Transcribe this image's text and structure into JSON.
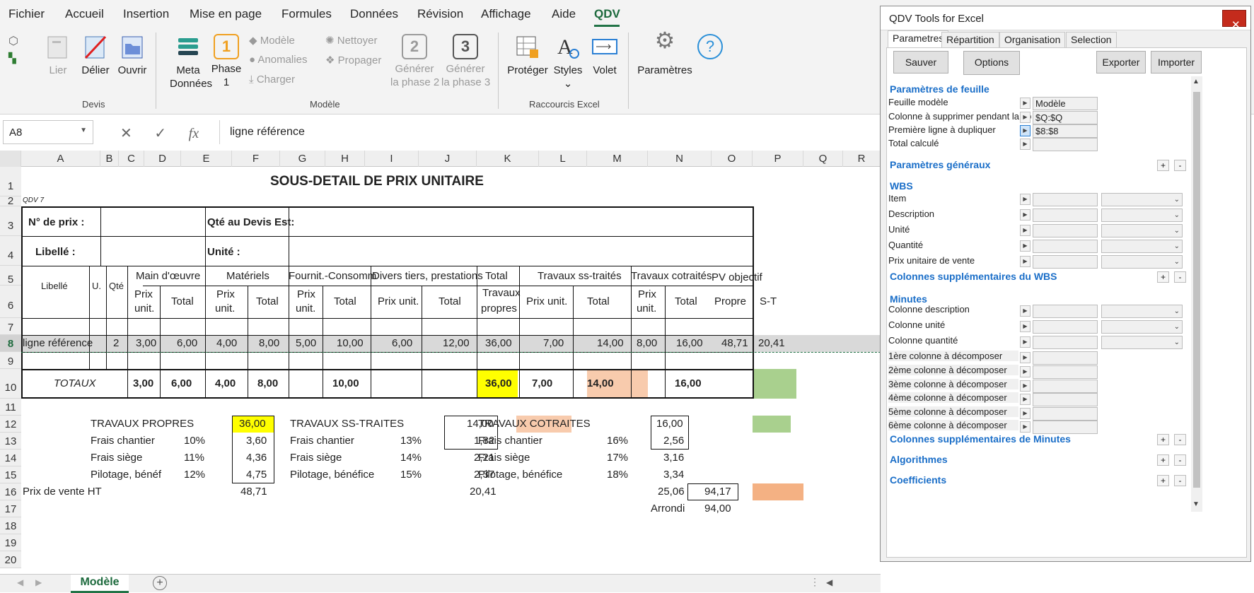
{
  "menu": [
    "Fichier",
    "Accueil",
    "Insertion",
    "Mise en page",
    "Formules",
    "Données",
    "Révision",
    "Affichage",
    "Aide",
    "QDV"
  ],
  "ribbon": {
    "devis": {
      "lier": "Lier",
      "delier": "Délier",
      "ouvrir": "Ouvrir",
      "group": "Devis"
    },
    "modele": {
      "meta1": "Meta",
      "meta2": "Données",
      "phase1a": "Phase",
      "phase1b": "1",
      "phase1_num": "1",
      "modele": "Modèle",
      "anomalies": "Anomalies",
      "charger": "Charger",
      "nettoyer": "Nettoyer",
      "propager": "Propager",
      "gen2a": "Générer",
      "gen2b": "la phase 2",
      "gen2_num": "2",
      "gen3a": "Générer",
      "gen3b": "la phase 3",
      "gen3_num": "3",
      "group": "Modèle"
    },
    "raccourcis": {
      "proteger": "Protéger",
      "styles": "Styles",
      "volet": "Volet",
      "group": "Raccourcis Excel"
    },
    "params": "Paramètres"
  },
  "namebox": "A8",
  "formula": "ligne référence",
  "columns": [
    "A",
    "B",
    "C",
    "D",
    "E",
    "F",
    "G",
    "H",
    "I",
    "J",
    "K",
    "L",
    "M",
    "N",
    "O",
    "P",
    "Q",
    "R"
  ],
  "rows": [
    "1",
    "2",
    "3",
    "4",
    "5",
    "6",
    "7",
    "8",
    "9",
    "10",
    "11",
    "12",
    "13",
    "14",
    "15",
    "16",
    "17",
    "18",
    "19",
    "20"
  ],
  "sheet": {
    "title": "SOUS-DETAIL DE PRIX UNITAIRE",
    "qdv7": "QDV 7",
    "no_prix": "N° de prix :",
    "qte_devis": "Qté au Devis Est:",
    "libelle_h": "Libellé :",
    "unite_h": "Unité :",
    "h_libelle": "Libellé",
    "h_u": "U.",
    "h_qte": "Qté",
    "h_main": "Main d'œuvre",
    "h_mat": "Matériels",
    "h_fourn": "Fournit.-Consomm",
    "h_divers": "Divers tiers, prestations",
    "h_total1": "Total",
    "h_total2": "Travaux",
    "h_total3": "propres",
    "h_sstr": "Travaux ss-traités",
    "h_cotr": "Travaux cotraités",
    "h_pv": "PV objectif",
    "h_prix": "Prix",
    "h_unit": "unit.",
    "h_total": "Total",
    "h_prixunit": "Prix unit.",
    "h_propre": "Propre",
    "h_st": "S-T",
    "row8": {
      "a": "ligne référence",
      "c": "2",
      "d": "3,00",
      "e": "6,00",
      "f": "4,00",
      "g": "8,00",
      "h": "5,00",
      "i": "10,00",
      "j": "6,00",
      "k": "12,00",
      "l": "36,00",
      "m": "7,00",
      "n": "14,00",
      "o": "8,00",
      "p": "16,00",
      "q": "48,71",
      "r": "20,41"
    },
    "totaux": {
      "label": "TOTAUX",
      "d": "3,00",
      "e": "6,00",
      "f": "4,00",
      "g": "8,00",
      "i": "10,00",
      "l": "36,00",
      "m": "7,00",
      "n": "14,00",
      "p": "16,00"
    },
    "summary": {
      "tp": "TRAVAUX PROPRES",
      "tp_v": "36,00",
      "tst": "TRAVAUX SS-TRAITES",
      "tst_v": "14,00",
      "tc": "TRAVAUX COTRAITES",
      "tc_v": "16,00",
      "frais_chantier": "Frais chantier",
      "frais_siege": "Frais siège",
      "pilotage1": "Pilotage, bénéf",
      "pilotage2": "Pilotage, bénéfice",
      "tp_fc_p": "10%",
      "tp_fc_v": "3,60",
      "tp_fs_p": "11%",
      "tp_fs_v": "4,36",
      "tp_pi_p": "12%",
      "tp_pi_v": "4,75",
      "st_fc_p": "13%",
      "st_fc_v": "1,82",
      "st_fs_p": "14%",
      "st_fs_v": "2,21",
      "st_pi_p": "15%",
      "st_pi_v": "2,37",
      "tc_fc_p": "16%",
      "tc_fc_v": "2,56",
      "tc_fs_p": "17%",
      "tc_fs_v": "3,16",
      "tc_pi_p": "18%",
      "tc_pi_v": "3,34",
      "pv_ht": "Prix de vente HT",
      "pv_tp": "48,71",
      "pv_st": "20,41",
      "pv_tc": "25,06",
      "pv_total": "94,17",
      "arrondi": "Arrondi",
      "arrondi_v": "94,00"
    }
  },
  "sheet_tab": "Modèle",
  "panel": {
    "title": "QDV Tools for Excel",
    "tabs": [
      "Parametres",
      "Répartition",
      "Organisation",
      "Selection"
    ],
    "buttons": {
      "sauver": "Sauver",
      "options": "Options",
      "exporter": "Exporter",
      "importer": "Importer"
    },
    "sec_feuille": "Paramètres de feuille",
    "feuille_modele": "Feuille modèle",
    "feuille_modele_v": "Modèle",
    "col_suppr": "Colonne à supprimer pendant la co",
    "col_suppr_v": "$Q:$Q",
    "prem_ligne": "Première ligne à dupliquer",
    "prem_ligne_v": "$8:$8",
    "total_calc": "Total calculé",
    "sec_generaux": "Paramètres généraux",
    "sec_wbs": "WBS",
    "wbs_items": [
      "Item",
      "Description",
      "Unité",
      "Quantité",
      "Prix unitaire de vente"
    ],
    "sec_col_wbs": "Colonnes supplémentaires du WBS",
    "sec_minutes": "Minutes",
    "min_items": [
      "Colonne description",
      "Colonne unité",
      "Colonne quantité"
    ],
    "decomp": [
      "1ère colonne à décomposer",
      "2ème colonne à décomposer",
      "3ème colonne à décomposer",
      "4ème colonne à décomposer",
      "5ème colonne à décomposer",
      "6ème colonne à décomposer"
    ],
    "sec_col_min": "Colonnes supplémentaires de Minutes",
    "sec_algo": "Algorithmes",
    "sec_coef": "Coefficients",
    "plus": "+",
    "minus": "-"
  },
  "colors": {
    "yellow": "#ffff00",
    "peach": "#f8cbad",
    "green": "#a9d08e",
    "orange": "#f4b183",
    "gray_row": "#d9d9d9",
    "accent": "#217346",
    "link": "#1a6ec8"
  }
}
